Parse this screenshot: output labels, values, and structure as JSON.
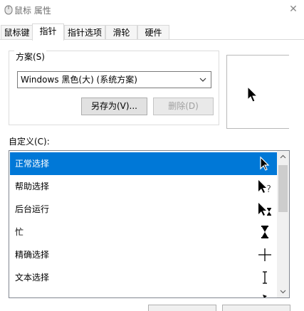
{
  "window": {
    "title": "鼠标 属性",
    "close_glyph": "✕"
  },
  "tabs": [
    {
      "label": "鼠标键",
      "active": false
    },
    {
      "label": "指针",
      "active": true
    },
    {
      "label": "指针选项",
      "active": false
    },
    {
      "label": "滑轮",
      "active": false
    },
    {
      "label": "硬件",
      "active": false
    }
  ],
  "scheme": {
    "group_label": "方案(S)",
    "selected": "Windows 黑色(大) (系统方案)",
    "save_as_label": "另存为(V)...",
    "delete_label": "删除(D)"
  },
  "custom": {
    "label": "自定义(C):",
    "items": [
      {
        "label": "正常选择",
        "icon": "arrow-cursor-icon",
        "selected": true
      },
      {
        "label": "帮助选择",
        "icon": "help-cursor-icon",
        "selected": false
      },
      {
        "label": "后台运行",
        "icon": "working-in-background-cursor-icon",
        "selected": false
      },
      {
        "label": "忙",
        "icon": "busy-hourglass-icon",
        "selected": false
      },
      {
        "label": "精确选择",
        "icon": "crosshair-cursor-icon",
        "selected": false
      },
      {
        "label": "文本选择",
        "icon": "text-ibeam-cursor-icon",
        "selected": false
      }
    ]
  },
  "colors": {
    "selection": "#0078d7",
    "selection_text": "#ffffff"
  }
}
